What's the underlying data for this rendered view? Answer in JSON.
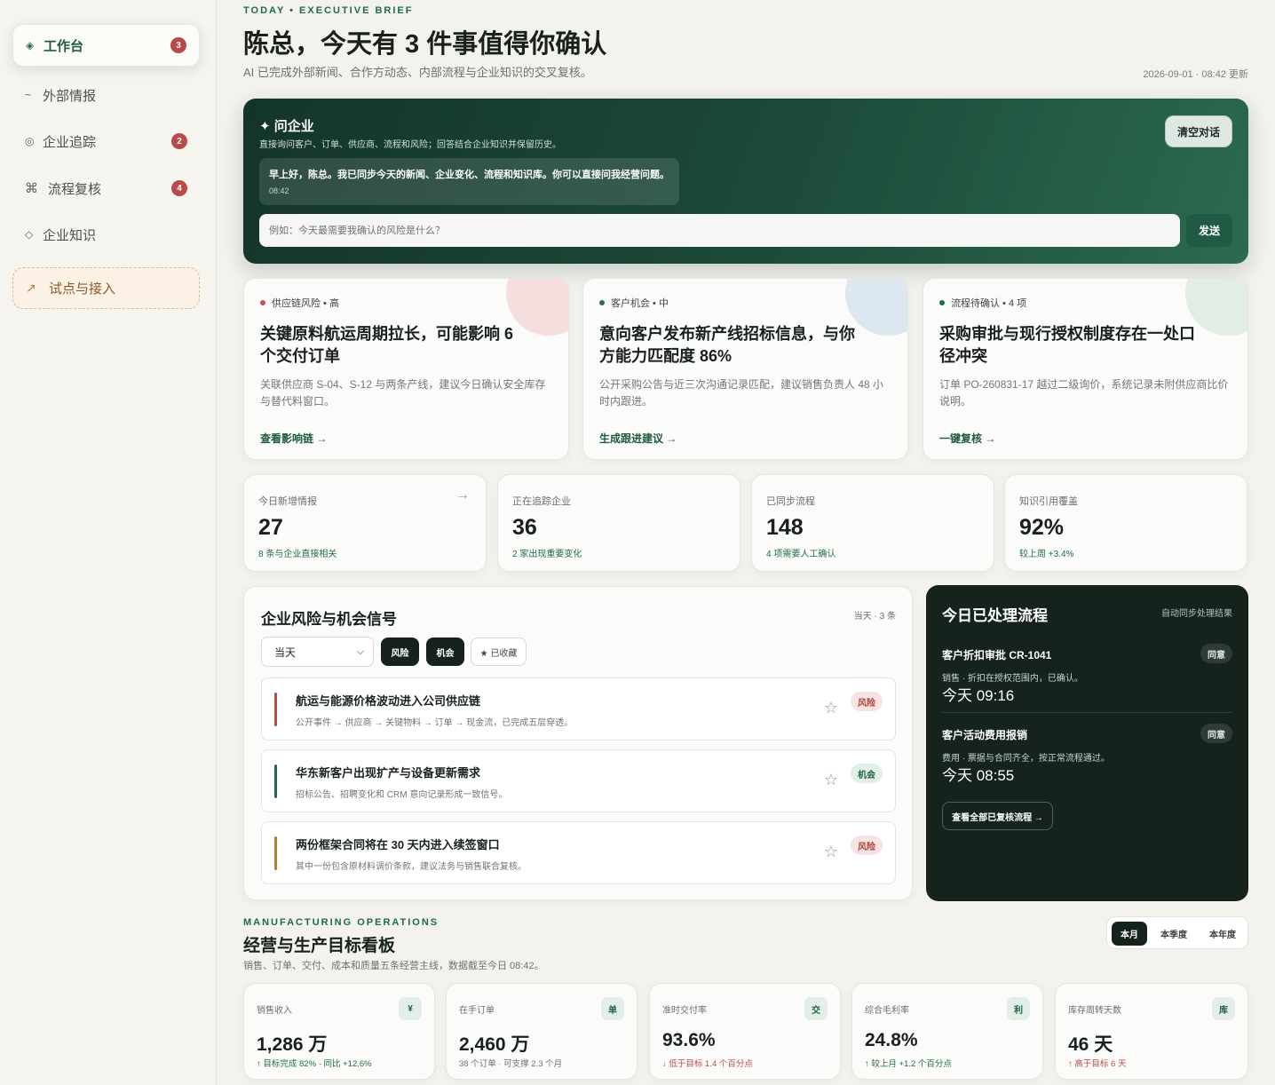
{
  "sidebar": {
    "items": [
      {
        "icon": "◈",
        "label": "工作台",
        "badge": "3"
      },
      {
        "icon": "~",
        "label": "外部情报",
        "badge": ""
      },
      {
        "icon": "◎",
        "label": "企业追踪",
        "badge": "2"
      },
      {
        "icon": "⌘",
        "label": "流程复核",
        "badge": "4"
      },
      {
        "icon": "◇",
        "label": "企业知识",
        "badge": ""
      }
    ],
    "pilot": {
      "icon": "↗",
      "label": "试点与接入"
    }
  },
  "header": {
    "eyebrow": "TODAY • EXECUTIVE BRIEF",
    "title": "陈总，今天有 3 件事值得你确认",
    "subtitle": "AI 已完成外部新闻、合作方动态、内部流程与企业知识的交叉复核。",
    "updated": "2026-09-01 · 08:42 更新"
  },
  "ask": {
    "title": "✦ 问企业",
    "subtitle": "直接询问客户、订单、供应商、流程和风险；回答结合企业知识并保留历史。",
    "clear_label": "清空对话",
    "message": "早上好，陈总。我已同步今天的新闻、企业变化、流程和知识库。你可以直接问我经营问题。",
    "message_time": "08:42",
    "placeholder": "例如：今天最需要我确认的风险是什么？",
    "send_label": "发送"
  },
  "briefs": [
    {
      "tag": "供应链风险 • 高",
      "title": "关键原料航运周期拉长，可能影响 6 个交付订单",
      "desc": "关联供应商 S-04、S-12 与两条产线，建议今日确认安全库存与替代料窗口。",
      "link": "查看影响链 →",
      "color": "#c0504d",
      "blob": "#f6dede"
    },
    {
      "tag": "客户机会 • 中",
      "title": "意向客户发布新产线招标信息，与你方能力匹配度 86%",
      "desc": "公开采购公告与近三次沟通记录匹配，建议销售负责人 48 小时内跟进。",
      "link": "生成跟进建议 →",
      "color": "#2e6b5a",
      "blob": "#dde7ef"
    },
    {
      "tag": "流程待确认 • 4 项",
      "title": "采购审批与现行授权制度存在一处口径冲突",
      "desc": "订单 PO-260831-17 越过二级询价，系统记录未附供应商比价说明。",
      "link": "一键复核 →",
      "color": "#1f6b4a",
      "blob": "#e2ede6"
    }
  ],
  "stats": [
    {
      "label": "今日新增情报",
      "value": "27",
      "note": "8 条与企业直接相关",
      "arrow": "→"
    },
    {
      "label": "正在追踪企业",
      "value": "36",
      "note": "2 家出现重要变化",
      "arrow": ""
    },
    {
      "label": "已同步流程",
      "value": "148",
      "note": "4 项需要人工确认",
      "arrow": ""
    },
    {
      "label": "知识引用覆盖",
      "value": "92%",
      "note": "较上周 +3.4%",
      "arrow": ""
    }
  ],
  "signals": {
    "title": "企业风险与机会信号",
    "meta": "当天 · 3 条",
    "select_value": "当天",
    "chips": [
      "风险",
      "机会",
      "★ 已收藏"
    ],
    "items": [
      {
        "title": "航运与能源价格波动进入公司供应链",
        "desc": "公开事件 → 供应商 → 关键物料 → 订单 → 现金流，已完成五层穿透。",
        "tag": "风险",
        "kind": "risk",
        "color": "#b84a47"
      },
      {
        "title": "华东新客户出现扩产与设备更新需求",
        "desc": "招标公告、招聘变化和 CRM 意向记录形成一致信号。",
        "tag": "机会",
        "kind": "opp",
        "color": "#1f6b4a"
      },
      {
        "title": "两份框架合同将在 30 天内进入续签窗口",
        "desc": "其中一份包含原材料调价条款，建议法务与销售联合复核。",
        "tag": "风险",
        "kind": "risk",
        "color": "#c07a2e"
      }
    ]
  },
  "flows": {
    "title": "今日已处理流程",
    "meta": "自动同步处理结果",
    "items": [
      {
        "title": "客户折扣审批 CR-1041",
        "desc": "销售 · 折扣在授权范围内，已确认。",
        "time": "今天 09:16",
        "status": "同意"
      },
      {
        "title": "客户活动费用报销",
        "desc": "费用 · 票据与合同齐全，按正常流程通过。",
        "time": "今天 08:55",
        "status": "同意"
      }
    ],
    "button": "查看全部已复核流程 →"
  },
  "ops": {
    "eyebrow": "MANUFACTURING OPERATIONS",
    "title": "经营与生产目标看板",
    "subtitle": "销售、订单、交付、成本和质量五条经营主线，数据截至今日 08:42。",
    "periods": [
      "本月",
      "本季度",
      "本年度"
    ],
    "kpis": [
      {
        "label": "销售收入",
        "icon": "¥",
        "value": "1,286 万",
        "note": "↑ 目标完成 82% · 同比 +12.6%",
        "tone": "good"
      },
      {
        "label": "在手订单",
        "icon": "单",
        "value": "2,460 万",
        "note": "38 个订单 · 可支撑 2.3 个月",
        "tone": "neutral"
      },
      {
        "label": "准时交付率",
        "icon": "交",
        "value": "93.6%",
        "note": "↓ 低于目标 1.4 个百分点",
        "tone": "bad"
      },
      {
        "label": "综合毛利率",
        "icon": "利",
        "value": "24.8%",
        "note": "↑ 较上月 +1.2 个百分点",
        "tone": "good"
      },
      {
        "label": "库存周转天数",
        "icon": "库",
        "value": "46 天",
        "note": "↑ 高于目标 6 天",
        "tone": "bad"
      }
    ]
  },
  "colors": {
    "accent": "#1f6b4a",
    "dark": "#16231d",
    "risk": "#b84a47"
  }
}
